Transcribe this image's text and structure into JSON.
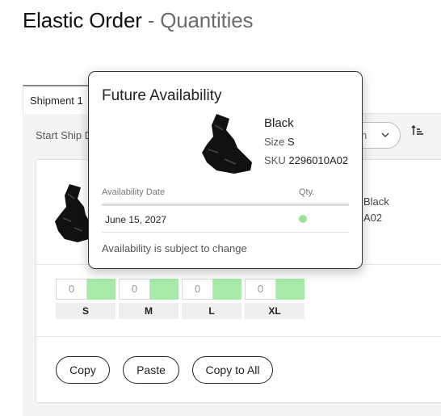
{
  "header": {
    "title": "Elastic Order",
    "separator": " - ",
    "subtitle": "Quantities"
  },
  "tabs": [
    {
      "label": "Shipment 1"
    }
  ],
  "filters": {
    "start_ship_label": "Start Ship D",
    "select_text": "n"
  },
  "product": {
    "color": "Black",
    "sku_fragment": "A02"
  },
  "sizes": [
    {
      "label": "S",
      "qty": "0"
    },
    {
      "label": "M",
      "qty": "0"
    },
    {
      "label": "L",
      "qty": "0"
    },
    {
      "label": "XL",
      "qty": "0"
    }
  ],
  "actions": {
    "copy": "Copy",
    "paste": "Paste",
    "copy_to_all": "Copy to All"
  },
  "popover": {
    "title": "Future Availability",
    "color": "Black",
    "size_label": "Size",
    "size_value": "S",
    "sku_label": "SKU",
    "sku_value": "2296010A02",
    "col_date": "Availability Date",
    "col_qty": "Qty.",
    "rows": [
      {
        "date": "June 15, 2027",
        "status_color": "#9be39b"
      }
    ],
    "note": "Availability is subject to change"
  },
  "colors": {
    "available": "#a7eaa9",
    "band": "#f4f4f4"
  }
}
